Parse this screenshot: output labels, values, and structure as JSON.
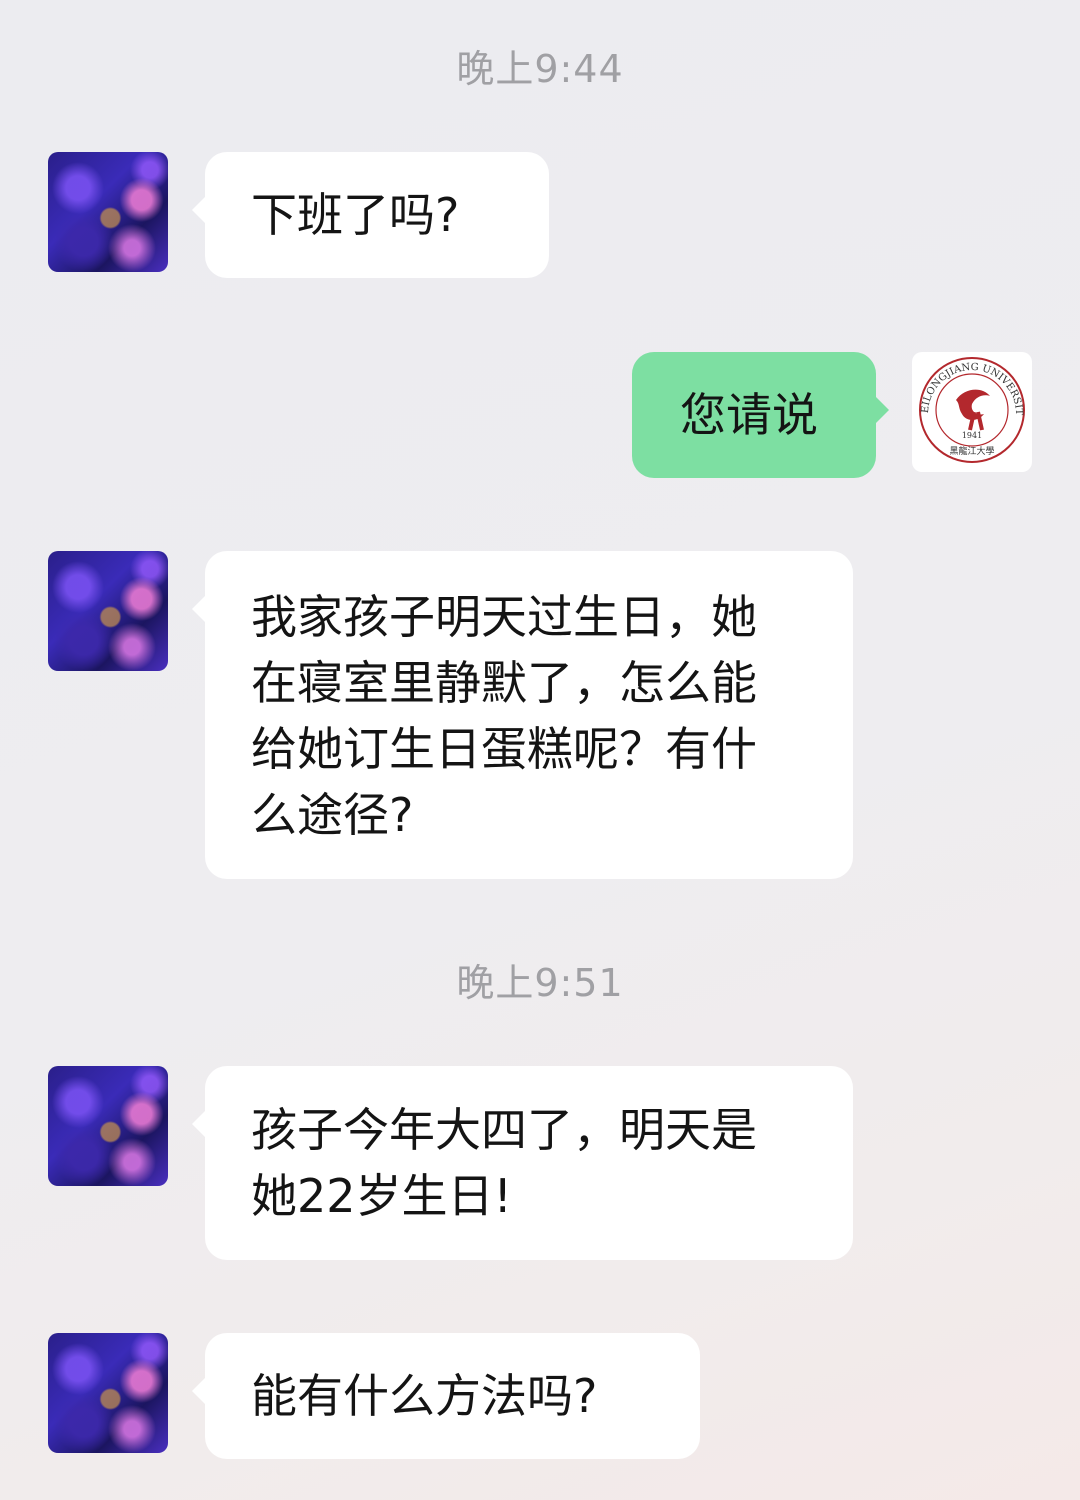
{
  "timestamps": [
    "晚上9:44",
    "晚上9:51"
  ],
  "messages": [
    {
      "side": "incoming",
      "text": "下班了吗?"
    },
    {
      "side": "outgoing",
      "text": "您请说"
    },
    {
      "side": "incoming",
      "text": "我家孩子明天过生日，她\n在寝室里静默了，怎么能\n给她订生日蛋糕呢？有什\n么途径?"
    },
    {
      "side": "incoming",
      "text": "孩子今年大四了，明天是\n她22岁生日!"
    },
    {
      "side": "incoming",
      "text": "能有什么方法吗?"
    }
  ],
  "avatars": {
    "contact": {
      "description_icon": "coral-reef-avatar"
    },
    "self": {
      "icon": "heilongjiang-university-logo",
      "logo_text": "HEILONGJIANG UNIVERSITY",
      "logo_year": "1941",
      "logo_chinese": "黑龍江大學"
    }
  },
  "colors": {
    "outgoing_bubble": "#7ddfa2",
    "incoming_bubble": "#ffffff",
    "logo_red": "#b3282d"
  }
}
